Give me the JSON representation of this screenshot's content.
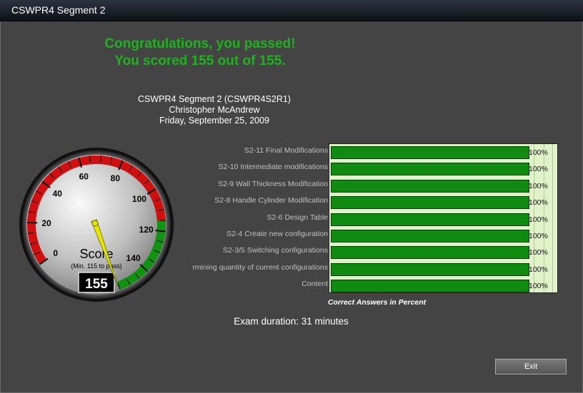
{
  "window": {
    "title": "CSWPR4 Segment 2"
  },
  "result": {
    "headline": "Congratulations, you passed!",
    "score_line": "You scored 155 out of 155."
  },
  "info": {
    "exam": "CSWPR4 Segment 2 (CSWPR4S2R1)",
    "candidate": "Christopher McAndrew",
    "date": "Friday, September 25, 2009"
  },
  "gauge": {
    "title": "Score",
    "subtitle": "(Min. 115 to pass)",
    "value": 155,
    "display": "155",
    "min": 0,
    "max": 155,
    "pass": 115,
    "ticks": [
      "0",
      "20",
      "40",
      "60",
      "80",
      "100",
      "120",
      "140"
    ],
    "colors": {
      "fail": "#d01010",
      "pass": "#129212",
      "needle": "#e6e600"
    }
  },
  "chart_data": {
    "type": "bar",
    "orientation": "horizontal",
    "categories": [
      "S2-11 Final Modifications",
      "S2-10 Intermediate modifications",
      "S2-9 Wall Thickness Modification",
      "S2-8 Handle Cylinder Modification",
      "S2-6 Design Table",
      "S2-4 Create new configuration",
      "S2-3/5 Switching configurations",
      "rmining quantity of current configurations",
      "Content"
    ],
    "values": [
      100,
      100,
      100,
      100,
      100,
      100,
      100,
      100,
      100
    ],
    "value_labels": [
      "100%",
      "100%",
      "100%",
      "100%",
      "100%",
      "100%",
      "100%",
      "100%",
      "100%"
    ],
    "xlabel": "Correct Answers in Percent",
    "xlim": [
      0,
      100
    ],
    "bar_color": "#118a11"
  },
  "footer": {
    "duration": "Exam duration: 31 minutes",
    "exit_label": "Exit"
  }
}
